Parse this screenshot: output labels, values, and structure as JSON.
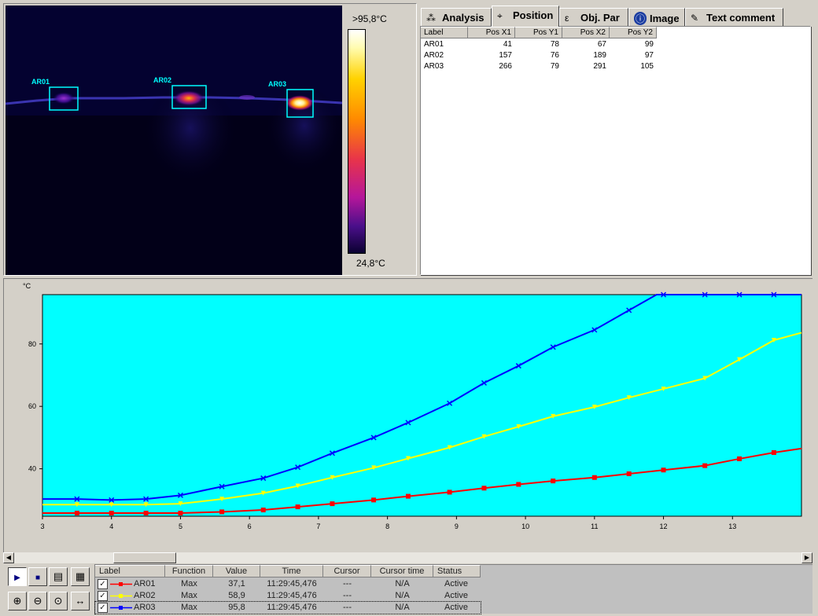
{
  "thermal": {
    "scale_max": ">95,8°C",
    "scale_min": "24,8°C",
    "areas": [
      {
        "label": "AR01"
      },
      {
        "label": "AR02"
      },
      {
        "label": "AR03"
      }
    ]
  },
  "tabs": [
    {
      "label": "Analysis",
      "icon": "analysis-icon"
    },
    {
      "label": "Position",
      "icon": "position-icon",
      "active": true
    },
    {
      "label": "Obj. Par",
      "icon": "object-parameters-icon"
    },
    {
      "label": "Image",
      "icon": "info-icon"
    },
    {
      "label": "Text comment",
      "icon": "text-comment-icon"
    }
  ],
  "position_table": {
    "columns": [
      "Label",
      "Pos X1",
      "Pos Y1",
      "Pos X2",
      "Pos Y2"
    ],
    "rows": [
      [
        "AR01",
        "41",
        "78",
        "67",
        "99"
      ],
      [
        "AR02",
        "157",
        "76",
        "189",
        "97"
      ],
      [
        "AR03",
        "266",
        "79",
        "291",
        "105"
      ]
    ]
  },
  "chart_data": {
    "type": "line",
    "ylabel": "°C",
    "xlim": [
      3,
      14
    ],
    "ylim": [
      24.8,
      95.8
    ],
    "x_ticks": [
      3,
      4,
      5,
      6,
      7,
      8,
      9,
      10,
      11,
      12,
      13
    ],
    "y_ticks": [
      40,
      60,
      80
    ],
    "background": "#00ffff",
    "series": [
      {
        "name": "AR01",
        "color": "#ff0000",
        "marker": "square",
        "x": [
          3,
          3.5,
          4,
          4.5,
          5,
          5.6,
          6.2,
          6.7,
          7.2,
          7.8,
          8.3,
          8.9,
          9.4,
          9.9,
          10.4,
          11,
          11.5,
          12,
          12.6,
          13.1,
          13.6,
          14
        ],
        "values": [
          25.8,
          25.8,
          25.8,
          25.8,
          25.8,
          26.2,
          26.8,
          27.8,
          28.8,
          30,
          31.2,
          32.5,
          33.8,
          35,
          36.1,
          37.2,
          38.4,
          39.6,
          41,
          43.2,
          45.2,
          46.5
        ],
        "marker_x": [
          3.5,
          4,
          4.5,
          5,
          5.6,
          6.2,
          6.7,
          7.2,
          7.8,
          8.3,
          8.9,
          9.4,
          9.9,
          10.4,
          11,
          11.5,
          12,
          12.6,
          13.1,
          13.6
        ]
      },
      {
        "name": "AR02",
        "color": "#ffff00",
        "marker": "triangle",
        "x": [
          3,
          3.5,
          4,
          4.5,
          5,
          5.6,
          6.2,
          6.7,
          7.2,
          7.8,
          8.3,
          8.9,
          9.4,
          9.9,
          10.4,
          11,
          11.5,
          12,
          12.6,
          13.1,
          13.6,
          14
        ],
        "values": [
          28.5,
          28.5,
          28.5,
          28.5,
          28.8,
          30.3,
          32.2,
          34.5,
          37.2,
          40.3,
          43.3,
          46.8,
          50.3,
          53.5,
          56.8,
          59.8,
          62.8,
          65.6,
          69,
          75,
          81.2,
          83.6
        ],
        "marker_x": [
          3.5,
          4,
          4.5,
          5,
          5.6,
          6.2,
          6.7,
          7.2,
          7.8,
          8.3,
          8.9,
          9.4,
          9.9,
          10.4,
          11,
          11.5,
          12,
          12.6,
          13.1,
          13.6
        ]
      },
      {
        "name": "AR03",
        "color": "#0000ff",
        "marker": "x",
        "x": [
          3,
          3.5,
          4,
          4.5,
          5,
          5.6,
          6.2,
          6.7,
          7.2,
          7.8,
          8.3,
          8.9,
          9.4,
          9.9,
          10.4,
          11,
          11.5,
          11.9,
          12.6,
          13.1,
          13.6,
          14
        ],
        "values": [
          30.3,
          30.3,
          30,
          30.3,
          31.5,
          34.3,
          37,
          40.5,
          45,
          50,
          54.8,
          61,
          67.5,
          73,
          79,
          84.5,
          90.8,
          95.8,
          95.8,
          95.8,
          95.8,
          95.8
        ],
        "marker_x": [
          3.5,
          4,
          4.5,
          5,
          5.6,
          6.2,
          6.7,
          7.2,
          7.8,
          8.3,
          8.9,
          9.4,
          9.9,
          10.4,
          11,
          11.5,
          12,
          12.6,
          13.1,
          13.6
        ]
      }
    ]
  },
  "toolbar": {
    "buttons": [
      {
        "name": "play-button",
        "icon": "play-icon",
        "glyph": "▶"
      },
      {
        "name": "stop-button",
        "icon": "stop-icon",
        "glyph": "■"
      },
      {
        "name": "chart-settings-button",
        "icon": "chart-settings-icon",
        "glyph": "▤"
      },
      {
        "name": "export-button",
        "icon": "export-icon",
        "glyph": "▦"
      },
      {
        "name": "zoom-in-button",
        "icon": "zoom-in-icon",
        "glyph": "⊕"
      },
      {
        "name": "zoom-out-button",
        "icon": "zoom-out-icon",
        "glyph": "⊖"
      },
      {
        "name": "zoom-fit-button",
        "icon": "zoom-fit-icon",
        "glyph": "⊙"
      },
      {
        "name": "pan-button",
        "icon": "horizontal-arrows-icon",
        "glyph": "↔"
      }
    ]
  },
  "legend_table": {
    "columns": [
      "Label",
      "Function",
      "Value",
      "Time",
      "Cursor",
      "Cursor time",
      "Status"
    ],
    "rows": [
      {
        "label": "AR01",
        "function": "Max",
        "value": "37,1",
        "time": "11:29:45,476",
        "cursor": "---",
        "cursor_time": "N/A",
        "status": "Active",
        "color": "#ff0000",
        "checked": "✓"
      },
      {
        "label": "AR02",
        "function": "Max",
        "value": "58,9",
        "time": "11:29:45,476",
        "cursor": "---",
        "cursor_time": "N/A",
        "status": "Active",
        "color": "#ffff00",
        "checked": "✓"
      },
      {
        "label": "AR03",
        "function": "Max",
        "value": "95,8",
        "time": "11:29:45,476",
        "cursor": "---",
        "cursor_time": "N/A",
        "status": "Active",
        "color": "#0000ff",
        "checked": "✓"
      }
    ]
  },
  "scrollbar": {
    "left_arrow": "◀",
    "right_arrow": "▶"
  }
}
